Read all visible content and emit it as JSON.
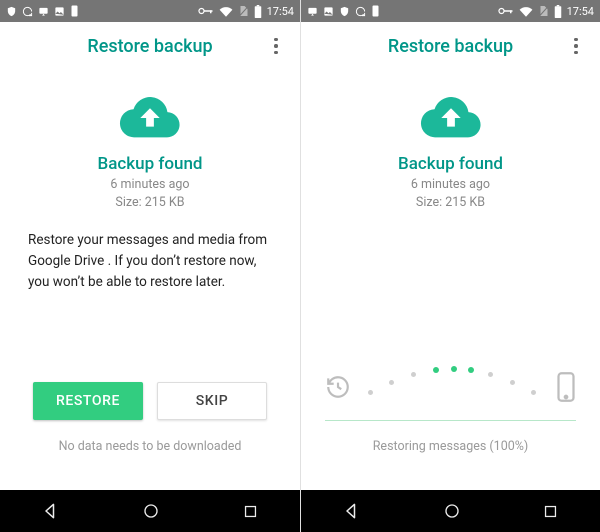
{
  "status": {
    "time": "17:54"
  },
  "header": {
    "title": "Restore backup"
  },
  "backup": {
    "found_label": "Backup found",
    "age": "6 minutes ago",
    "size": "Size: 215 KB"
  },
  "left": {
    "description": "Restore your messages and media from Google Drive . If you don’t restore now, you won’t be able to restore later.",
    "restore_btn": "RESTORE",
    "skip_btn": "SKIP",
    "footnote": "No data needs to be downloaded"
  },
  "right": {
    "progress_text": "Restoring messages (100%)"
  }
}
